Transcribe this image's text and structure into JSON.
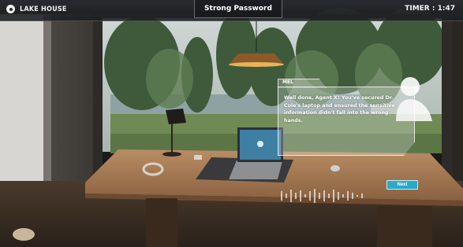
{
  "hud": {
    "location_icon": "location-pin-icon",
    "location": "LAKE HOUSE",
    "title": "Strong Password",
    "timer": "TIMER : 1:47"
  },
  "dialog": {
    "speaker": "MEL",
    "message": "Well done, Agent X! You've secured Dr. Cole's laptop and ensured the sensitive information didn't fall into the wrong hands.",
    "next_label": "Next"
  },
  "colors": {
    "accent": "#2aa9c9",
    "hud_bg": "#282c30",
    "text": "#ffffff"
  }
}
